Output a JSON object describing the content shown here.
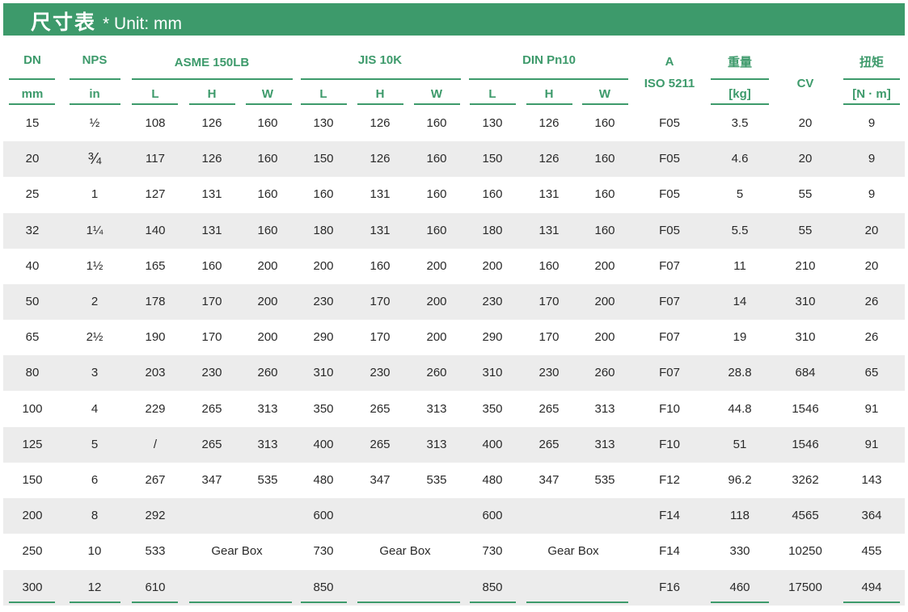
{
  "title": {
    "main": "尺寸表",
    "unit": "* Unit: mm"
  },
  "headers": {
    "dn": "DN",
    "dn_unit": "mm",
    "nps": "NPS",
    "nps_unit": "in",
    "asme": "ASME 150LB",
    "jis": "JIS 10K",
    "din": "DIN Pn10",
    "l": "L",
    "h": "H",
    "w": "W",
    "a_line1": "A",
    "a_line2": "ISO 5211",
    "weight": "重量",
    "weight_unit": "[kg]",
    "cv": "CV",
    "torque": "扭矩",
    "torque_unit": "[N · m]"
  },
  "gear_box_label": "Gear Box",
  "rows": [
    [
      "15",
      "½",
      "108",
      "126",
      "160",
      "130",
      "126",
      "160",
      "130",
      "126",
      "160",
      "F05",
      "3.5",
      "20",
      "9"
    ],
    [
      "20",
      "¾",
      "117",
      "126",
      "160",
      "150",
      "126",
      "160",
      "150",
      "126",
      "160",
      "F05",
      "4.6",
      "20",
      "9"
    ],
    [
      "25",
      "1",
      "127",
      "131",
      "160",
      "160",
      "131",
      "160",
      "160",
      "131",
      "160",
      "F05",
      "5",
      "55",
      "9"
    ],
    [
      "32",
      "1¼",
      "140",
      "131",
      "160",
      "180",
      "131",
      "160",
      "180",
      "131",
      "160",
      "F05",
      "5.5",
      "55",
      "20"
    ],
    [
      "40",
      "1½",
      "165",
      "160",
      "200",
      "200",
      "160",
      "200",
      "200",
      "160",
      "200",
      "F07",
      "11",
      "210",
      "20"
    ],
    [
      "50",
      "2",
      "178",
      "170",
      "200",
      "230",
      "170",
      "200",
      "230",
      "170",
      "200",
      "F07",
      "14",
      "310",
      "26"
    ],
    [
      "65",
      "2½",
      "190",
      "170",
      "200",
      "290",
      "170",
      "200",
      "290",
      "170",
      "200",
      "F07",
      "19",
      "310",
      "26"
    ],
    [
      "80",
      "3",
      "203",
      "230",
      "260",
      "310",
      "230",
      "260",
      "310",
      "230",
      "260",
      "F07",
      "28.8",
      "684",
      "65"
    ],
    [
      "100",
      "4",
      "229",
      "265",
      "313",
      "350",
      "265",
      "313",
      "350",
      "265",
      "313",
      "F10",
      "44.8",
      "1546",
      "91"
    ],
    [
      "125",
      "5",
      "/",
      "265",
      "313",
      "400",
      "265",
      "313",
      "400",
      "265",
      "313",
      "F10",
      "51",
      "1546",
      "91"
    ],
    [
      "150",
      "6",
      "267",
      "347",
      "535",
      "480",
      "347",
      "535",
      "480",
      "347",
      "535",
      "F12",
      "96.2",
      "3262",
      "143"
    ],
    [
      "200",
      "8",
      "292",
      "",
      "",
      "600",
      "",
      "",
      "600",
      "",
      "",
      "F14",
      "118",
      "4565",
      "364"
    ],
    [
      "250",
      "10",
      "533",
      "",
      "",
      "730",
      "",
      "",
      "730",
      "",
      "",
      "F14",
      "330",
      "10250",
      "455"
    ],
    [
      "300",
      "12",
      "610",
      "",
      "",
      "850",
      "",
      "",
      "850",
      "",
      "",
      "F16",
      "460",
      "17500",
      "494"
    ]
  ]
}
